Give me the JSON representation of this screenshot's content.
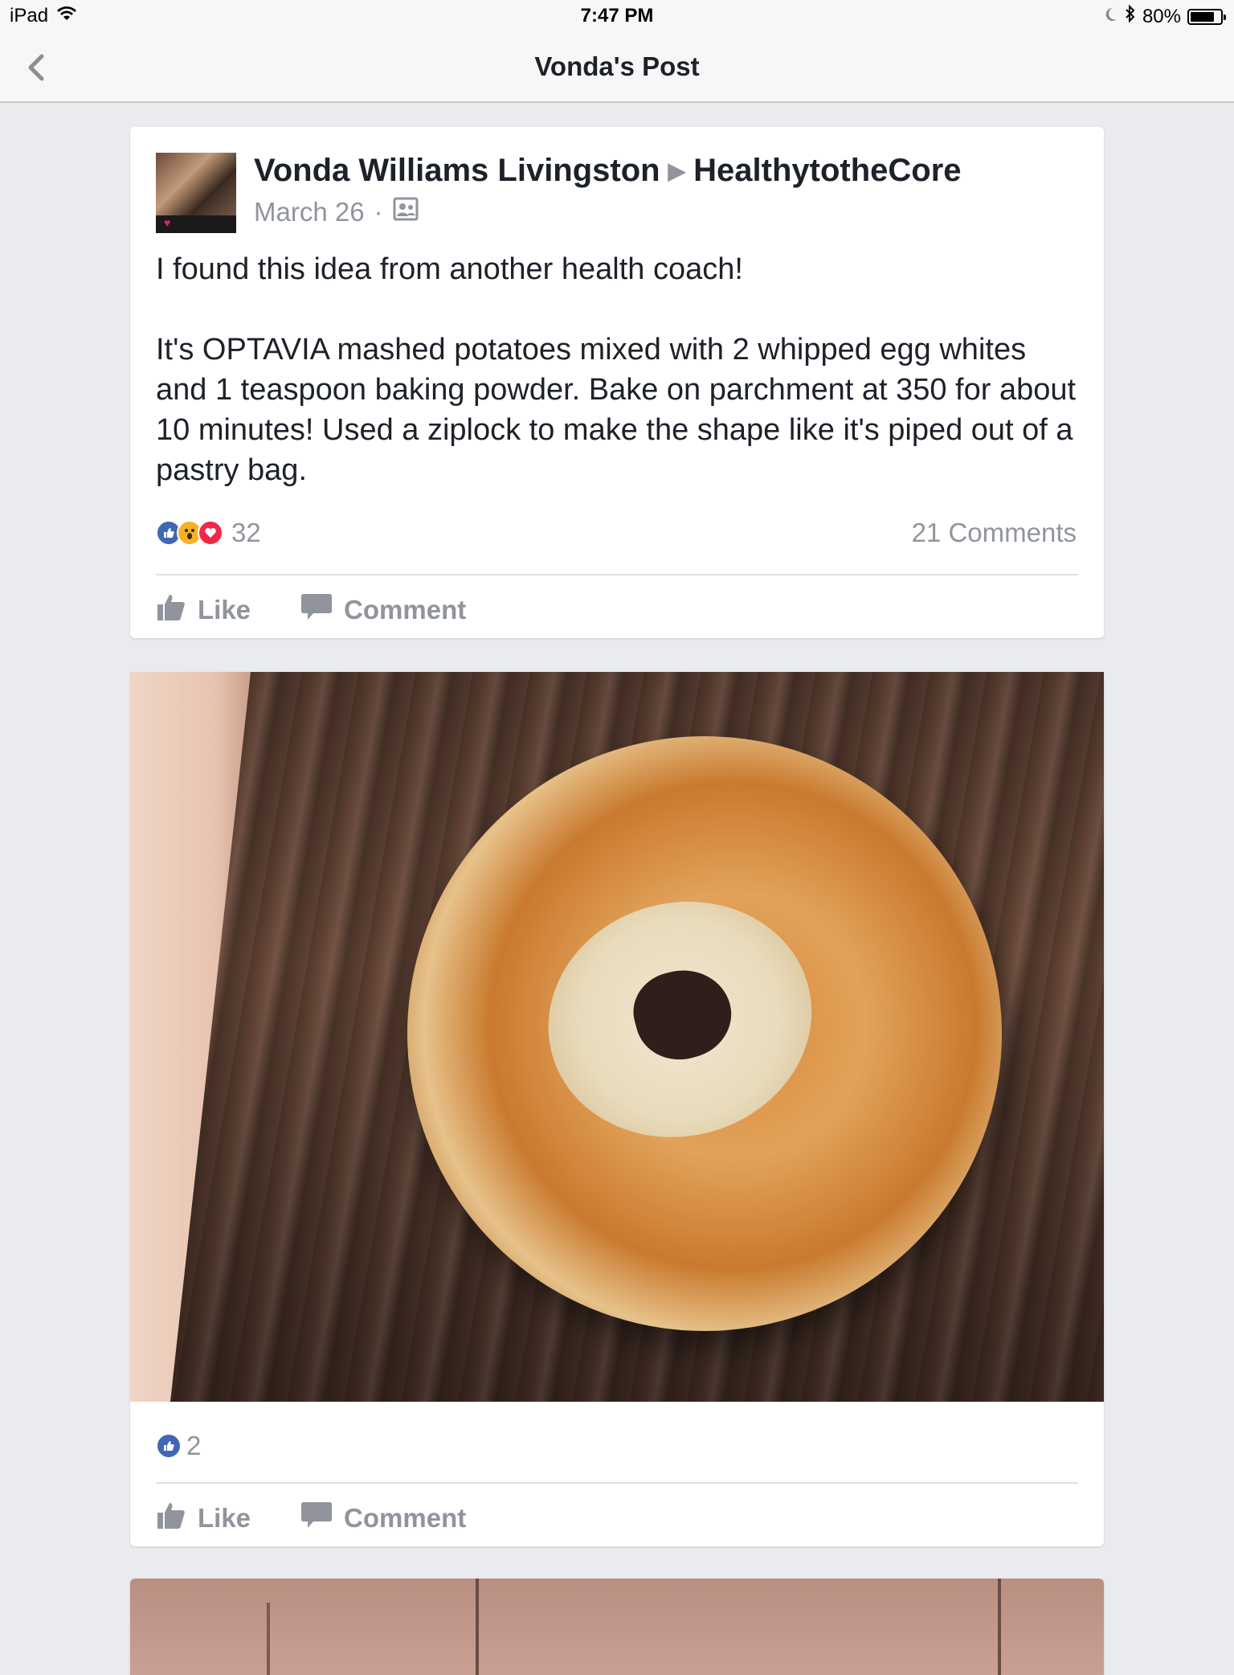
{
  "status_bar": {
    "device": "iPad",
    "time": "7:47 PM",
    "battery_percent": "80%",
    "battery_level": 0.8
  },
  "nav": {
    "title": "Vonda's Post"
  },
  "post": {
    "author": "Vonda Williams Livingston",
    "group": "HealthytotheCore",
    "date": "March 26",
    "separator": "·",
    "text_1": "I found this idea from another health coach!",
    "text_2": "It's OPTAVIA mashed potatoes mixed with 2 whipped egg whites and 1 teaspoon baking powder. Bake on parchment at 350 for about 10 minutes! Used a ziplock to make the shape like it's piped out of a pastry bag.",
    "reaction_count": "32",
    "comments_label": "21 Comments",
    "like_label": "Like",
    "comment_label": "Comment"
  },
  "photo_post": {
    "reaction_count": "2",
    "like_label": "Like",
    "comment_label": "Comment"
  },
  "colors": {
    "background": "#e9ebee",
    "like_blue": "#4267b2",
    "love_red": "#f0284a",
    "wow_yellow": "#f7b125",
    "muted_text": "#90949c"
  }
}
